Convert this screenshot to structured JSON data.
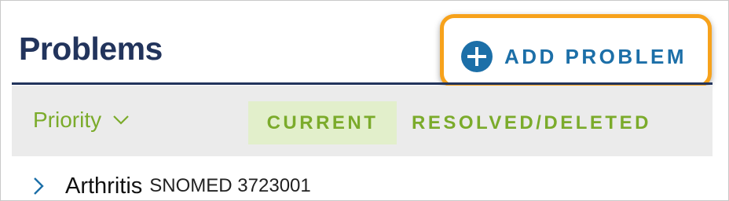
{
  "header": {
    "title": "Problems",
    "add_button_label": "ADD PROBLEM",
    "add_icon": "plus-circle-icon"
  },
  "filters": {
    "sort_label": "Priority",
    "sort_icon": "chevron-down-icon",
    "tabs": [
      {
        "label": "CURRENT",
        "selected": true
      },
      {
        "label": "RESOLVED/DELETED",
        "selected": false
      }
    ]
  },
  "problems": [
    {
      "name": "Arthritis",
      "code": "SNOMED 3723001",
      "expand_icon": "chevron-right-icon"
    }
  ],
  "colors": {
    "title": "#22345c",
    "accent_blue": "#1c6fa8",
    "accent_green": "#7bab2b",
    "selected_tab_bg": "#e2efcb",
    "highlight_orange": "#f7a21b",
    "toolbar_bg": "#ebebeb"
  }
}
